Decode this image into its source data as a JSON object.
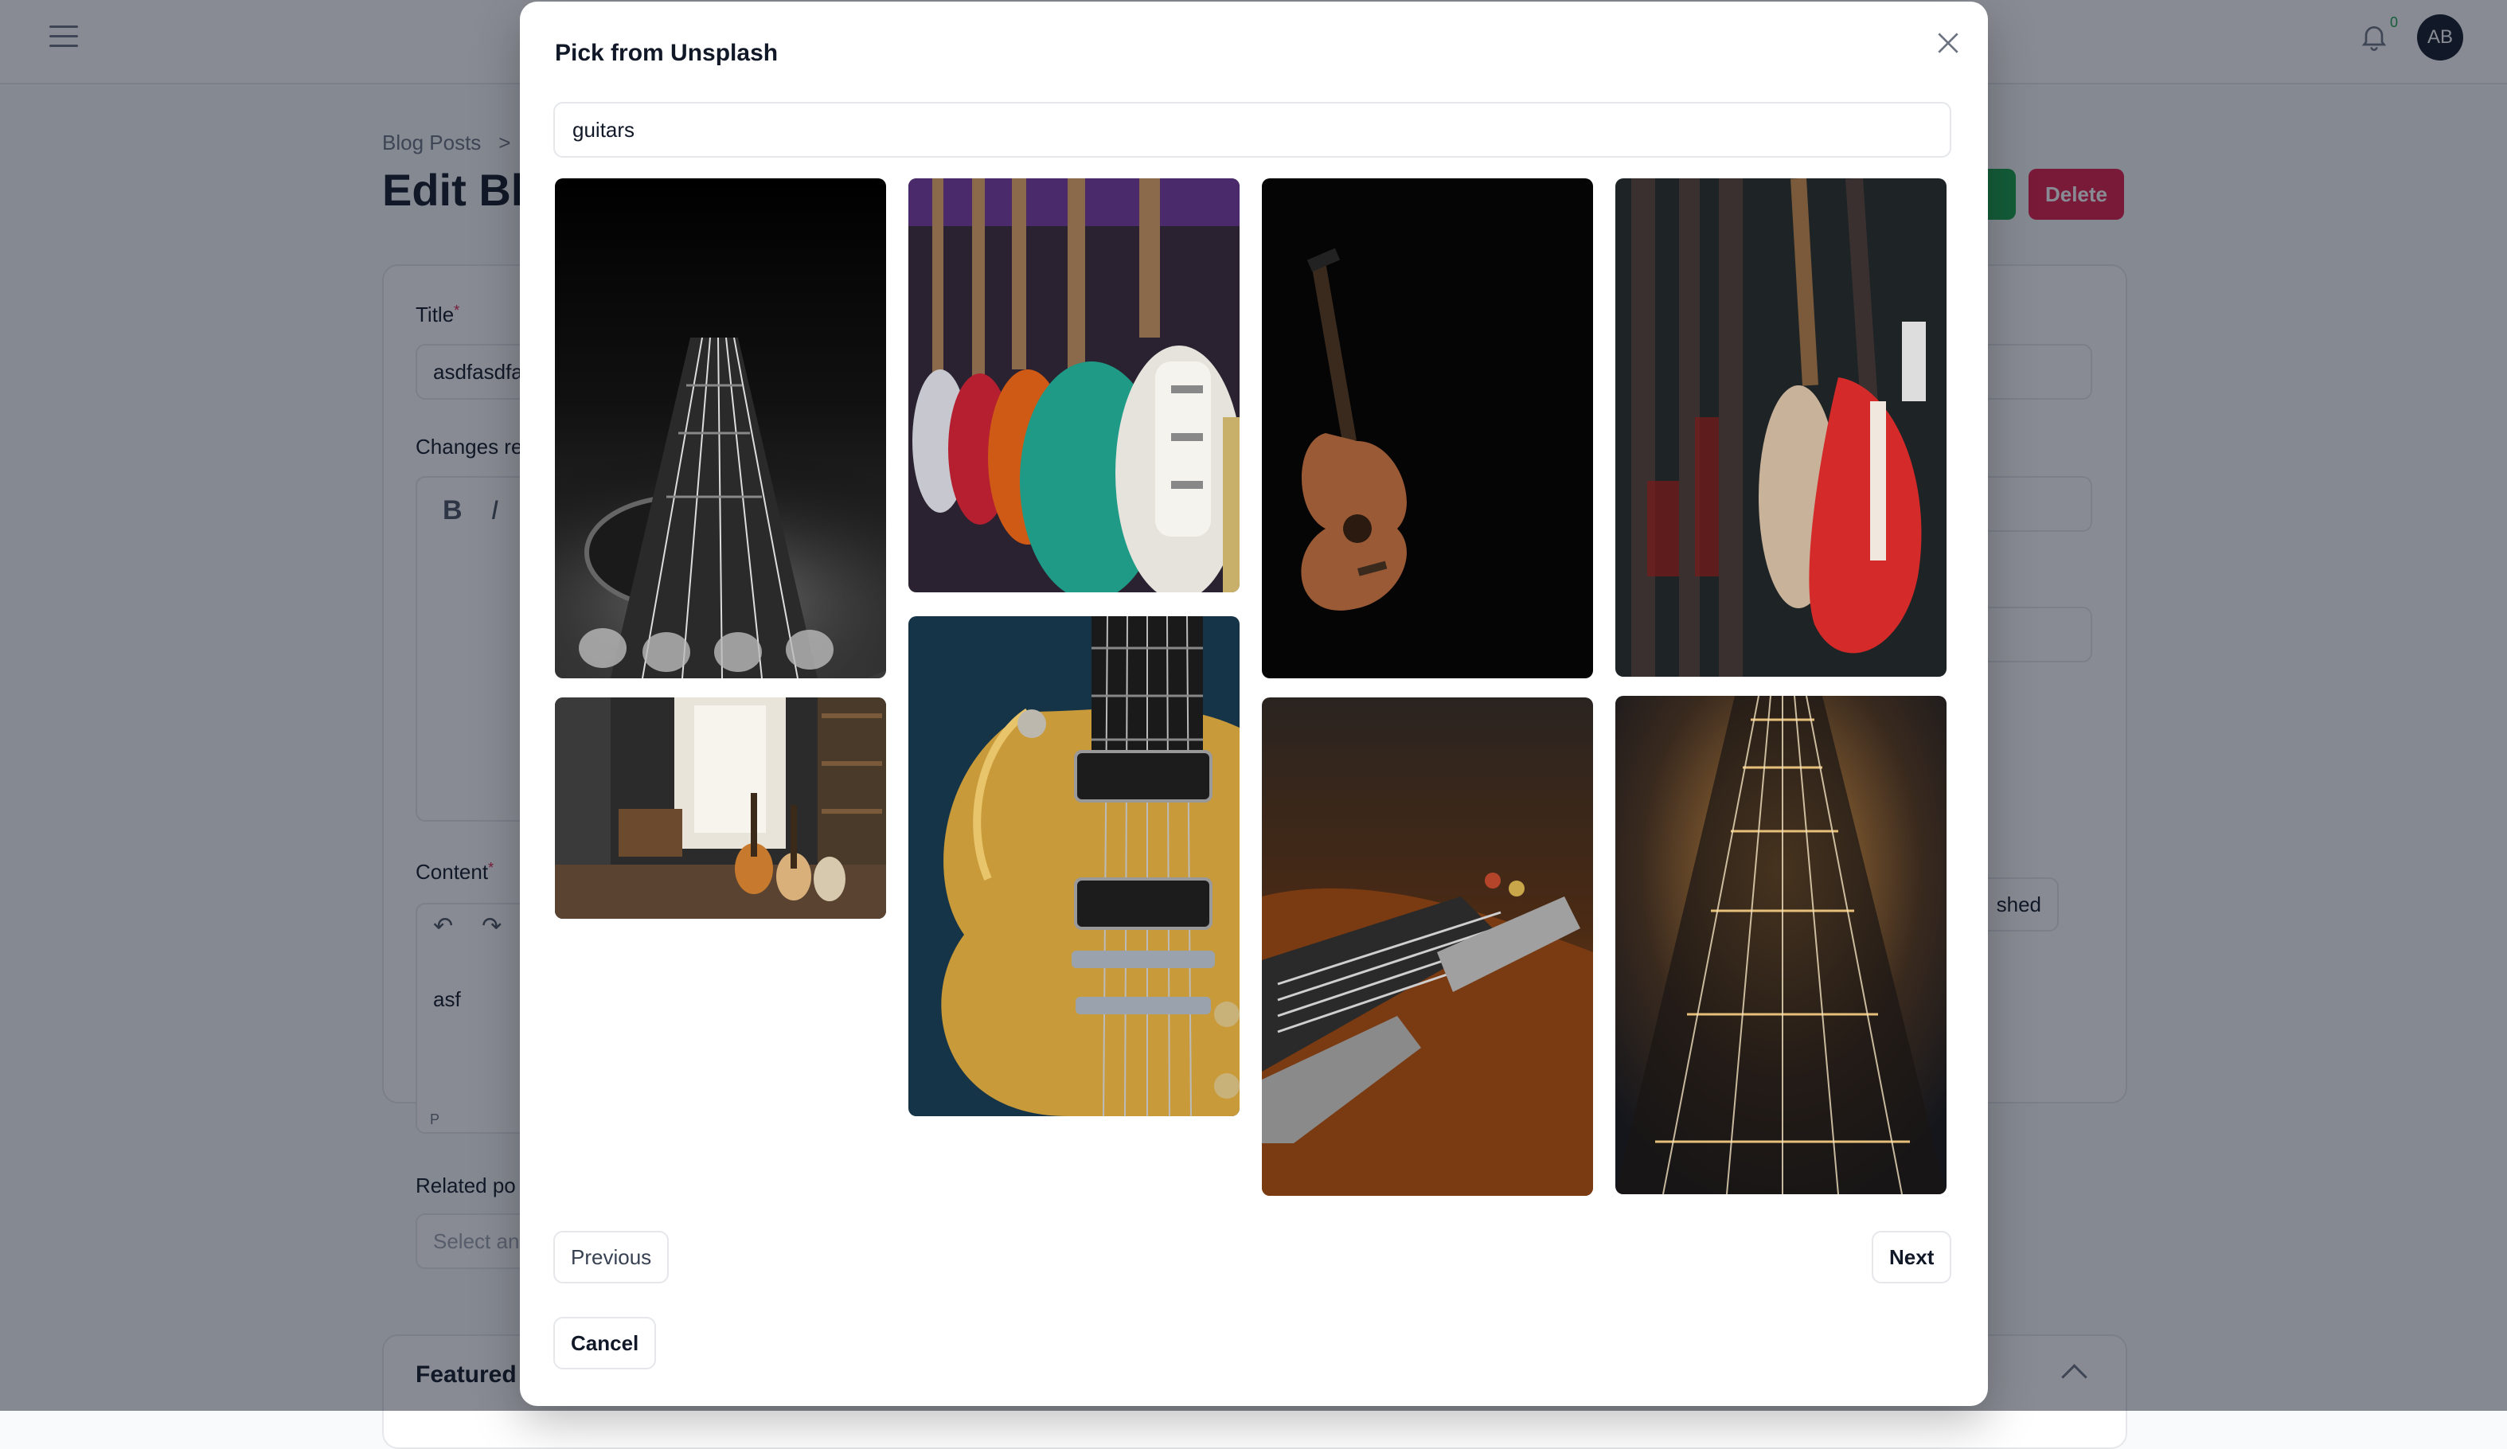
{
  "app": {
    "notification_count": "0",
    "avatar_initials": "AB",
    "breadcrumb": [
      "Blog Posts",
      ">"
    ],
    "page_title": "Edit Blo",
    "delete_label": "Delete",
    "title_label": "Title",
    "title_value": "asdfasdfa",
    "changes_label": "Changes re",
    "content_label": "Content",
    "content_value": "asf",
    "paragraph_tag": "P",
    "related_label": "Related po",
    "related_placeholder": "Select an",
    "status_fragment": "shed",
    "featured_label": "Featured"
  },
  "modal": {
    "title": "Pick from Unsplash",
    "search_value": "guitars",
    "images": [
      {
        "name": "guitar-neck-bw"
      },
      {
        "name": "guitars-on-wall-row"
      },
      {
        "name": "acoustic-guitar-dark"
      },
      {
        "name": "red-guitars-store"
      },
      {
        "name": "guitars-in-room"
      },
      {
        "name": "les-paul-gold"
      },
      {
        "name": "guitar-bridge-wood"
      },
      {
        "name": "fretboard-closeup"
      }
    ],
    "previous_label": "Previous",
    "next_label": "Next",
    "cancel_label": "Cancel"
  }
}
